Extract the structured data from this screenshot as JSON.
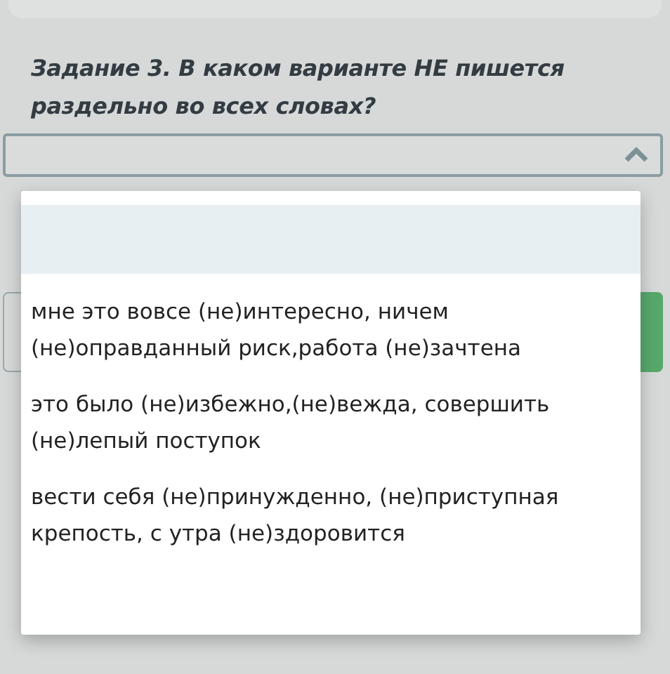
{
  "question": {
    "title": "Задание 3. В каком варианте НЕ пишется раздельно во всех словах?"
  },
  "dropdown": {
    "expanded": true
  },
  "options": [
    {
      "kind": "blank",
      "selected": true
    },
    {
      "kind": "answer",
      "text": "мне это вовсе (не)интересно, ничем (не)оправданный риск,работа (не)зачтена",
      "selected": false
    },
    {
      "kind": "answer",
      "text": "это было (не)избежно,(не)вежда, совершить (не)лепый поступок",
      "selected": false
    },
    {
      "kind": "answer",
      "text": "вести себя (не)принужденно, (не)приступная крепость, с утра (не)здоровится",
      "selected": false
    }
  ]
}
